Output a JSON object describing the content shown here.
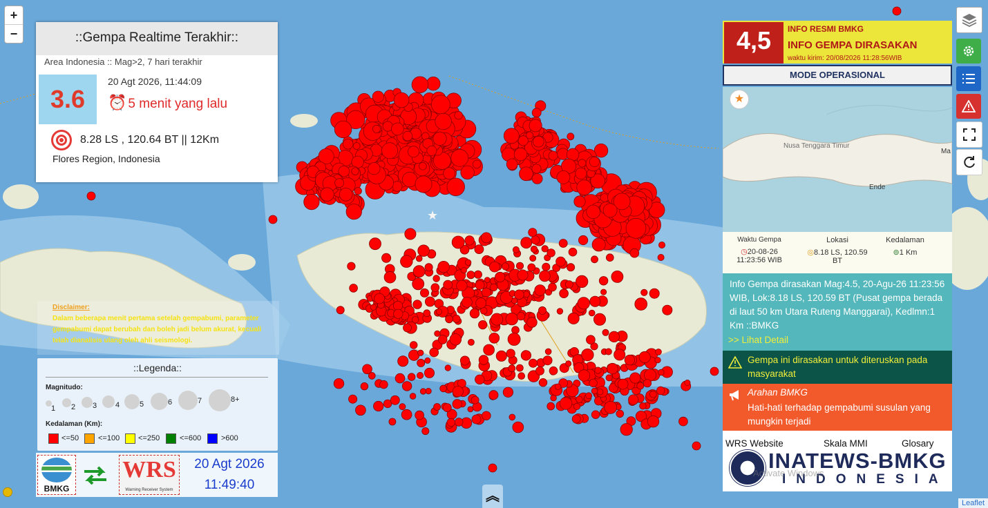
{
  "zoom": {
    "in_label": "+",
    "out_label": "−"
  },
  "latest_quake": {
    "title": "::Gempa Realtime Terakhir::",
    "area": "Area Indonesia :: Mag>2, 7 hari terakhir",
    "magnitude": "3.6",
    "datetime": "20 Agt 2026, 11:44:09",
    "ago": "5 menit yang lalu",
    "location": "8.28 LS , 120.64 BT || 12Km",
    "region": "Flores Region, Indonesia"
  },
  "disclaimer": {
    "title": "Disclaimer:",
    "text": "Dalam beberapa menit pertama setelah gempabumi, parameter gempabumi dapat berubah dan boleh jadi belum akurat, kecuali telah dianalisis ulang oleh ahli seismologi."
  },
  "legend": {
    "title": "::Legenda::",
    "magnitude_label": "Magnitudo:",
    "magnitudes": [
      "1",
      "2",
      "3",
      "4",
      "5",
      "6",
      "7",
      "8+"
    ],
    "depth_label": "Kedalaman (Km):",
    "depths": [
      {
        "label": "<=50",
        "color": "#ff0000"
      },
      {
        "label": "<=100",
        "color": "#ffa500"
      },
      {
        "label": "<=250",
        "color": "#ffff00"
      },
      {
        "label": "<=600",
        "color": "#008000"
      },
      {
        "label": ">600",
        "color": "#0000ff"
      }
    ]
  },
  "bottom_bar": {
    "bmkg_label": "BMKG",
    "wrs_label": "WRS",
    "wrs_sub": "Warning Receiver System",
    "date": "20 Agt 2026",
    "time": "11:49:40"
  },
  "felt_quake": {
    "magnitude": "4,5",
    "line1": "INFO RESMI BMKG",
    "line2": "INFO GEMPA DIRASAKAN",
    "line3": "waktu kirim: 20/08/2026 11:28:56WIB",
    "mode": "MODE OPERASIONAL",
    "map_labels": {
      "region": "Nusa Tenggara Timur",
      "city": "Ende",
      "edge": "Ma"
    },
    "params": {
      "time_label": "Waktu Gempa",
      "time_value_1": "20-08-26",
      "time_value_2": "11:23:56 WIB",
      "loc_label": "Lokasi",
      "loc_value_1": "8.18 LS, 120.59",
      "loc_value_2": "BT",
      "depth_label": "Kedalaman",
      "depth_value": "1 Km"
    },
    "description": "Info Gempa dirasakan Mag:4.5, 20-Agu-26 11:23:56 WIB, Lok:8.18 LS, 120.59 BT (Pusat gempa berada di laut 50 km Utara Ruteng Manggarai), Kedlmn:1 Km ::BMKG",
    "detail_link": ">> Lihat Detail",
    "felt_note": "Gempa ini dirasakan untuk diteruskan pada masyarakat",
    "warning_title": "Arahan BMKG",
    "warning_text": "Hati-hati terhadap gempabumi susulan yang mungkin terjadi",
    "links": [
      "WRS Website",
      "Skala MMI",
      "Glosary"
    ],
    "inatews_main": "INATEWS-BMKG",
    "inatews_sub": "INDONESIA"
  },
  "watermark": "Activate Windows",
  "attribution": "Leaflet",
  "tools": [
    "layers-icon",
    "settings-icon",
    "list-icon",
    "warning-icon",
    "fullscreen-icon",
    "refresh-icon"
  ]
}
